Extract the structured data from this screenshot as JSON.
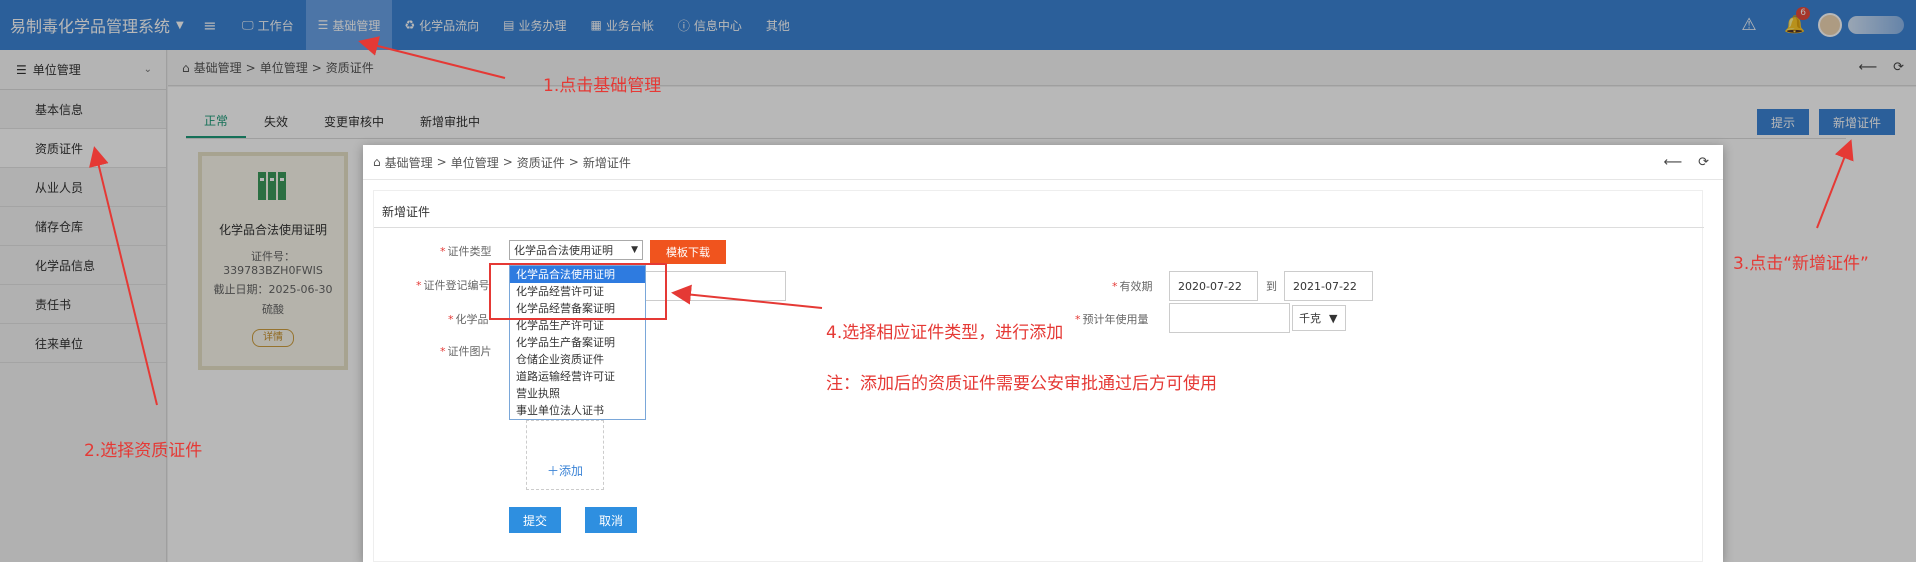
{
  "app": {
    "title": "易制毒化学品管理系统"
  },
  "topnav": {
    "items": [
      {
        "label": "工作台",
        "icon": "monitor-icon"
      },
      {
        "label": "基础管理",
        "icon": "list-icon"
      },
      {
        "label": "化学品流向",
        "icon": "recycle-icon"
      },
      {
        "label": "业务办理",
        "icon": "briefcase-icon"
      },
      {
        "label": "业务台帐",
        "icon": "ledger-icon"
      },
      {
        "label": "信息中心",
        "icon": "info-icon"
      },
      {
        "label": "其他",
        "icon": ""
      }
    ],
    "notification_count": "6"
  },
  "sidebar": {
    "header": "单位管理",
    "items": [
      "基本信息",
      "资质证件",
      "从业人员",
      "储存仓库",
      "化学品信息",
      "责任书",
      "往来单位"
    ]
  },
  "breadcrumb": {
    "home": "基础管理",
    "sep": ">",
    "level2": "单位管理",
    "level3": "资质证件"
  },
  "tabs": [
    "正常",
    "失效",
    "变更审核中",
    "新增审批中"
  ],
  "top_buttons": {
    "hint": "提示",
    "add": "新增证件"
  },
  "card": {
    "title": "化学品合法使用证明",
    "number": "证件号：339783BZH0FWIS",
    "expiry": "截止日期：2025-06-30",
    "chemical": "硫酸",
    "detail": "详情"
  },
  "modal": {
    "breadcrumb": {
      "home": "基础管理",
      "level2": "单位管理",
      "level3": "资质证件",
      "level4": "新增证件"
    },
    "panel_title": "新增证件",
    "form": {
      "cert_type_label": "证件类型",
      "cert_type_value": "化学品合法使用证明",
      "template_button": "模板下载",
      "reg_no_label": "证件登记编号",
      "chemical_label": "化学品",
      "image_label": "证件图片",
      "validity_label": "有效期",
      "date_from": "2020-07-22",
      "to_label": "到",
      "date_to": "2021-07-22",
      "annual_usage_label": "预计年使用量",
      "unit": "千克",
      "add_label": "添加",
      "submit": "提交",
      "cancel": "取消"
    },
    "dropdown_options": [
      "化学品合法使用证明",
      "化学品经营许可证",
      "化学品经营备案证明",
      "化学品生产许可证",
      "化学品生产备案证明",
      "仓储企业资质证件",
      "道路运输经营许可证",
      "营业执照",
      "事业单位法人证书"
    ]
  },
  "annotations": {
    "step1": "1.点击基础管理",
    "step2": "2.选择资质证件",
    "step3": "3.点击“新增证件”",
    "step4": "4.选择相应证件类型，进行添加",
    "note": "注：添加后的资质证件需要公安审批通过后方可使用"
  },
  "colors": {
    "nav_bg": "#3c84d6",
    "nav_active": "#6aa3e8",
    "annotation_red": "#e53935",
    "template_btn": "#f0541e",
    "tab_active": "#1e9c7a"
  }
}
